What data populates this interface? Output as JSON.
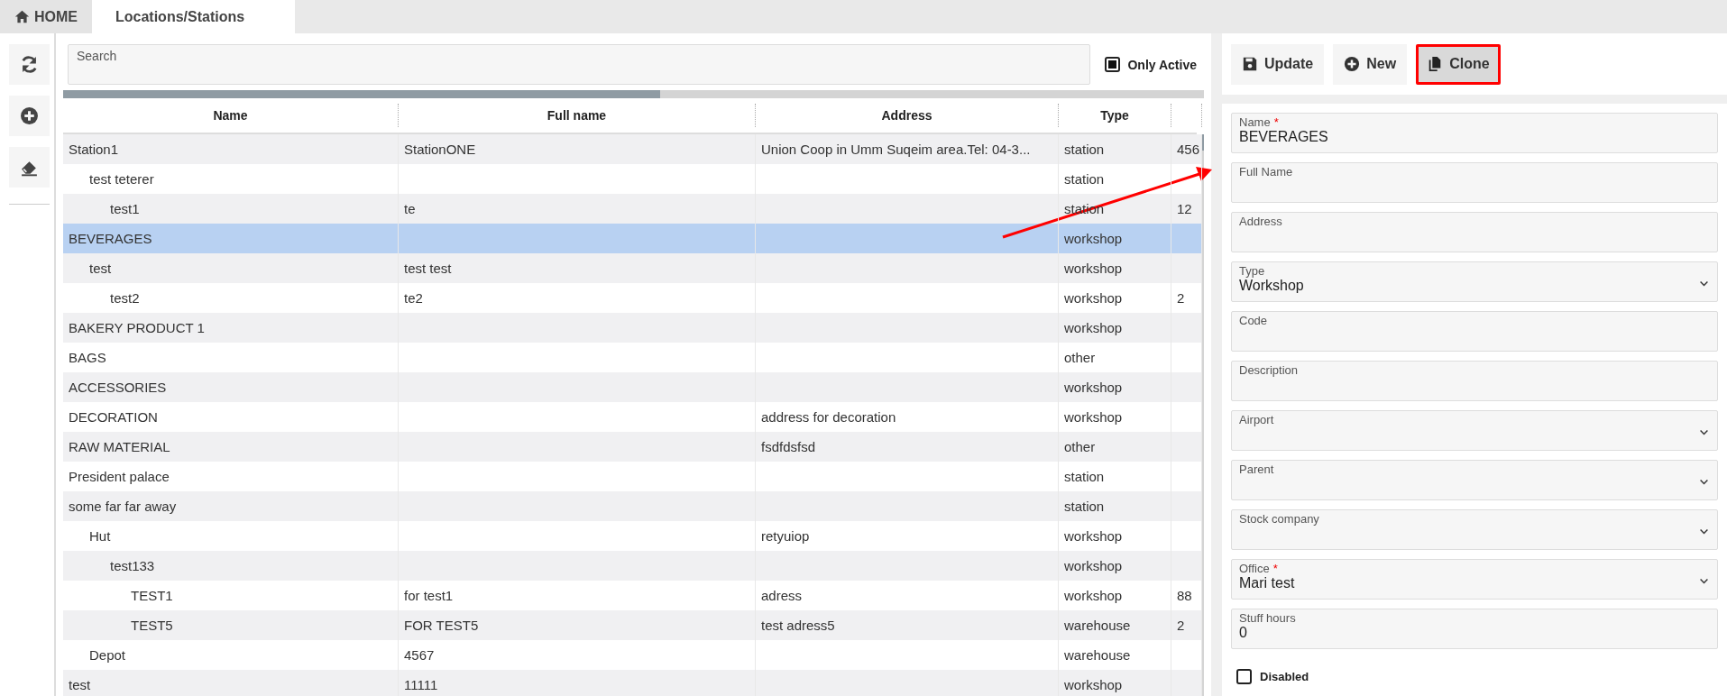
{
  "tabs": [
    {
      "label": "HOME",
      "kind": "home",
      "selected": false
    },
    {
      "label": "Locations/Stations",
      "kind": "page",
      "selected": true
    }
  ],
  "tools": [
    {
      "kind": "refresh"
    },
    {
      "kind": "add"
    },
    {
      "kind": "erase"
    }
  ],
  "search": {
    "placeholder": "Search"
  },
  "only_active": {
    "label": "Only Active",
    "checked": true
  },
  "table": {
    "columns": [
      "Name",
      "Full name",
      "Address",
      "Type",
      ""
    ],
    "rows": [
      {
        "name": "Station1",
        "full_name": "StationONE",
        "address": "Union Coop in Umm Suqeim area.Tel: 04-3...",
        "type": "station",
        "column_5": "456",
        "selected": false,
        "children": [
          {
            "name": "test teterer",
            "type": "station",
            "selected": false,
            "children": [
              {
                "name": "test1",
                "full_name": "te",
                "type": "station",
                "column_5": "12",
                "selected": false
              }
            ]
          }
        ]
      },
      {
        "name": "BEVERAGES",
        "type": "workshop",
        "selected": true,
        "children": [
          {
            "name": "test",
            "full_name": "test test",
            "type": "workshop",
            "selected": false,
            "children": [
              {
                "name": "test2",
                "full_name": "te2",
                "type": "workshop",
                "column_5": "2",
                "selected": false
              }
            ]
          }
        ]
      },
      {
        "name": "BAKERY PRODUCT 1",
        "type": "workshop",
        "selected": false
      },
      {
        "name": "BAGS",
        "type": "other",
        "selected": false
      },
      {
        "name": "ACCESSORIES",
        "type": "workshop",
        "selected": false
      },
      {
        "name": "DECORATION",
        "address": "address for decoration",
        "type": "workshop",
        "selected": false
      },
      {
        "name": "RAW MATERIAL",
        "address": "fsdfdsfsd",
        "type": "other",
        "selected": false
      },
      {
        "name": "President palace",
        "type": "station",
        "selected": false
      },
      {
        "name": "some far far away",
        "type": "station",
        "selected": false,
        "children": [
          {
            "name": "Hut",
            "address": "retyuiop",
            "type": "workshop",
            "selected": false,
            "children": [
              {
                "name": "test133",
                "type": "workshop",
                "selected": false,
                "children": [
                  {
                    "name": "TEST1",
                    "full_name": "for test1",
                    "address": "adress",
                    "type": "workshop",
                    "column_5": "88",
                    "selected": false
                  },
                  {
                    "name": "TEST5",
                    "full_name": "FOR TEST5",
                    "address": "test adress5",
                    "type": "warehouse",
                    "column_5": "2",
                    "selected": false
                  }
                ]
              }
            ]
          },
          {
            "name": "Depot",
            "full_name": "4567",
            "type": "warehouse",
            "selected": false
          }
        ]
      },
      {
        "name": "test",
        "full_name": "11111",
        "type": "workshop",
        "selected": false
      }
    ]
  },
  "actions": [
    {
      "label": "Update",
      "kind": "save",
      "highlighted": false
    },
    {
      "label": "New",
      "kind": "new",
      "highlighted": false
    },
    {
      "label": "Clone",
      "kind": "clone",
      "highlighted": true
    }
  ],
  "form": {
    "fields": [
      {
        "label": "Name",
        "kind": "text",
        "required_mark": "*",
        "value": "BEVERAGES"
      },
      {
        "label": "Full Name",
        "kind": "text"
      },
      {
        "label": "Address",
        "kind": "text"
      },
      {
        "label": "Type",
        "kind": "select",
        "value": "Workshop"
      },
      {
        "label": "Code",
        "kind": "text"
      },
      {
        "label": "Description",
        "kind": "text"
      },
      {
        "label": "Airport",
        "kind": "select"
      },
      {
        "label": "Parent",
        "kind": "select"
      },
      {
        "label": "Stock company",
        "kind": "select"
      },
      {
        "label": "Office",
        "kind": "select",
        "required_mark": "*",
        "value": "Mari test"
      },
      {
        "label": "Stuff hours",
        "kind": "text",
        "value": "0"
      }
    ],
    "disabled": {
      "label": "Disabled",
      "checked": false
    }
  }
}
